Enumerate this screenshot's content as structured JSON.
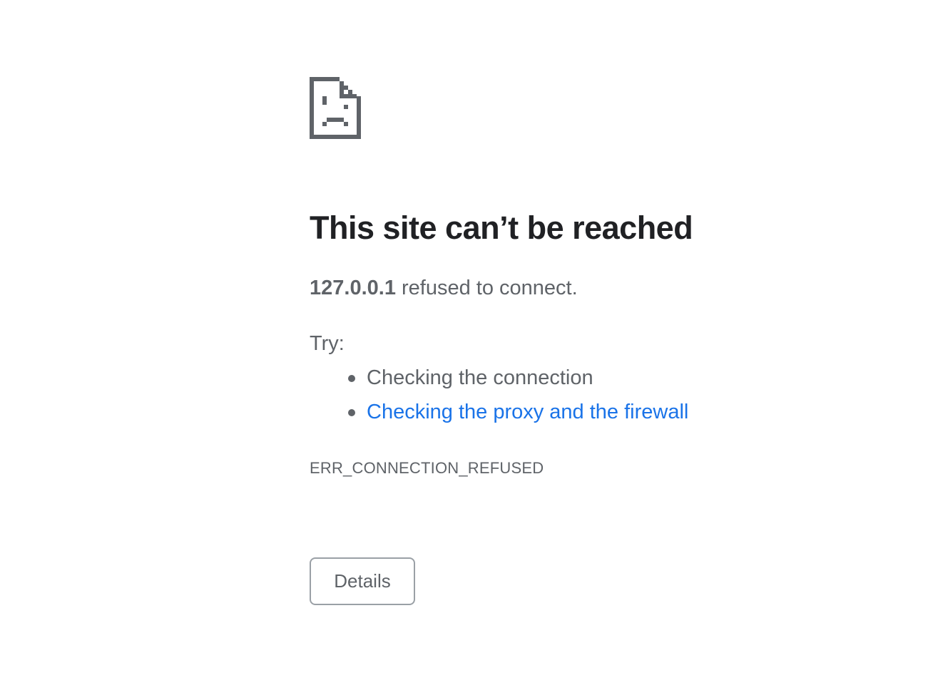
{
  "error_page": {
    "icon": "sad-page-icon",
    "title": "This site can’t be reached",
    "summary": {
      "host": "127.0.0.1",
      "message": " refused to connect."
    },
    "try_label": "Try:",
    "suggestions": [
      {
        "text": "Checking the connection",
        "is_link": false
      },
      {
        "text": "Checking the proxy and the firewall",
        "is_link": true
      }
    ],
    "error_code": "ERR_CONNECTION_REFUSED",
    "details_button_label": "Details"
  },
  "colors": {
    "background": "#ffffff",
    "title": "#202124",
    "text": "#5f6368",
    "link": "#1a73e8",
    "button_border": "#9aa0a6"
  }
}
